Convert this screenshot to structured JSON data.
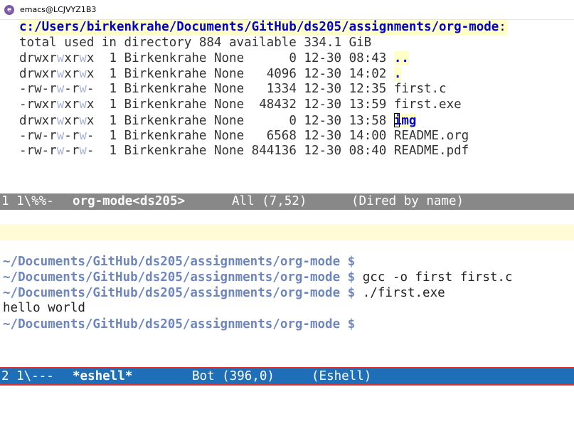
{
  "window": {
    "title": "emacs@LCJVYZ1B3",
    "icon": "emacs-icon"
  },
  "dired": {
    "header_path": "c:/Users/birkenkrahe/Documents/GitHub/ds205/assignments/org-mode",
    "header_colon": ":",
    "total_line": "total used in directory 884 available 334.1 GiB",
    "entries": [
      {
        "perm_a": "drwxr",
        "perm_w1": "w",
        "perm_b": "xr",
        "perm_w2": "w",
        "perm_c": "x",
        "info": "  1 Birkenkrahe None      0 12-30 08:43 ",
        "name": ".."
      },
      {
        "perm_a": "drwxr",
        "perm_w1": "w",
        "perm_b": "xr",
        "perm_w2": "w",
        "perm_c": "x",
        "info": "  1 Birkenkrahe None   4096 12-30 14:02 ",
        "name": "."
      },
      {
        "perm_a": "-rw-r",
        "perm_w1": "w",
        "perm_b": "-r",
        "perm_w2": "w",
        "perm_c": "-",
        "info": "  1 Birkenkrahe None   1334 12-30 12:35 ",
        "name": "first.c"
      },
      {
        "perm_a": "-rwxr",
        "perm_w1": "w",
        "perm_b": "xr",
        "perm_w2": "w",
        "perm_c": "x",
        "info": "  1 Birkenkrahe None  48432 12-30 13:59 ",
        "name": "first.exe"
      },
      {
        "perm_a": "drwxr",
        "perm_w1": "w",
        "perm_b": "xr",
        "perm_w2": "w",
        "perm_c": "x",
        "info": "  1 Birkenkrahe None      0 12-30 13:58 ",
        "name": "img"
      },
      {
        "perm_a": "-rw-r",
        "perm_w1": "w",
        "perm_b": "-r",
        "perm_w2": "w",
        "perm_c": "-",
        "info": "  1 Birkenkrahe None   6568 12-30 14:00 ",
        "name": "README.org"
      },
      {
        "perm_a": "-rw-r",
        "perm_w1": "w",
        "perm_b": "-r",
        "perm_w2": "w",
        "perm_c": "-",
        "info": "  1 Birkenkrahe None 844136 12-30 08:40 ",
        "name": "README.pdf"
      }
    ]
  },
  "modeline_top": {
    "state": "1 1\\%%-",
    "buffer": "org-mode<ds205>",
    "position": "All (7,52)",
    "mode": "(Dired by name)"
  },
  "eshell": {
    "lines": [
      {
        "prompt": "~/Documents/GitHub/ds205/assignments/org-mode",
        "sign": "$",
        "command": ""
      },
      {
        "prompt": "~/Documents/GitHub/ds205/assignments/org-mode",
        "sign": "$",
        "command": "gcc -o first first.c"
      },
      {
        "prompt": "~/Documents/GitHub/ds205/assignments/org-mode",
        "sign": "$",
        "command": "./first.exe"
      }
    ],
    "output": "hello world",
    "current_prompt": "~/Documents/GitHub/ds205/assignments/org-mode",
    "current_sign": "$"
  },
  "modeline_bottom": {
    "state": "2 1\\---",
    "buffer": "*eshell*",
    "position": "Bot (396,0)",
    "mode": "(Eshell)"
  },
  "colors": {
    "dired_dir": "#0000d0",
    "highlight": "#ffffc8",
    "prompt": "#6e86c0",
    "modeline_inactive": "#888888",
    "modeline_active": "#1f6fb8",
    "modeline_active_border": "#e03030"
  }
}
